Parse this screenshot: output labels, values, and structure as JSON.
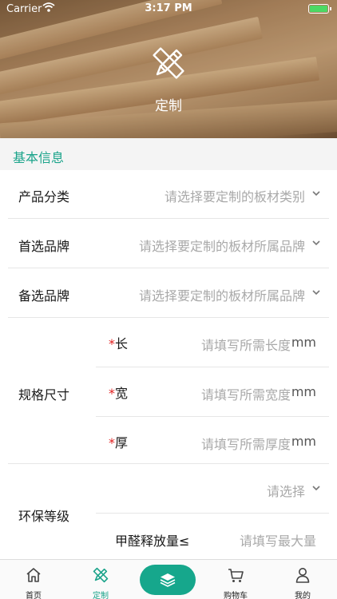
{
  "status_bar": {
    "carrier": "Carrier",
    "time": "3:17 PM"
  },
  "header": {
    "title": "定制",
    "icon": "ruler-pencil-icon"
  },
  "section": {
    "title": "基本信息"
  },
  "form": {
    "category": {
      "label": "产品分类",
      "placeholder": "请选择要定制的板材类别"
    },
    "preferred_brand": {
      "label": "首选品牌",
      "placeholder": "请选择要定制的板材所属品牌"
    },
    "backup_brand": {
      "label": "备选品牌",
      "placeholder": "请选择要定制的板材所属品牌"
    },
    "spec": {
      "label": "规格尺寸",
      "length": {
        "star": "*",
        "label": "长",
        "placeholder": "请填写所需长度",
        "unit": "mm"
      },
      "width": {
        "star": "*",
        "label": "宽",
        "placeholder": "请填写所需宽度",
        "unit": "mm"
      },
      "thickness": {
        "star": "*",
        "label": "厚",
        "placeholder": "请填写所需厚度",
        "unit": "mm"
      }
    },
    "env": {
      "label": "环保等级",
      "select_placeholder": "请选择",
      "formaldehyde_label": "甲醛释放量≤",
      "formaldehyde_placeholder": "请填写最大量"
    }
  },
  "tabbar": {
    "home": "首页",
    "custom": "定制",
    "cart": "购物车",
    "mine": "我的"
  },
  "colors": {
    "accent": "#1aa38a",
    "required": "#e02020",
    "placeholder": "#a9a9a9"
  }
}
